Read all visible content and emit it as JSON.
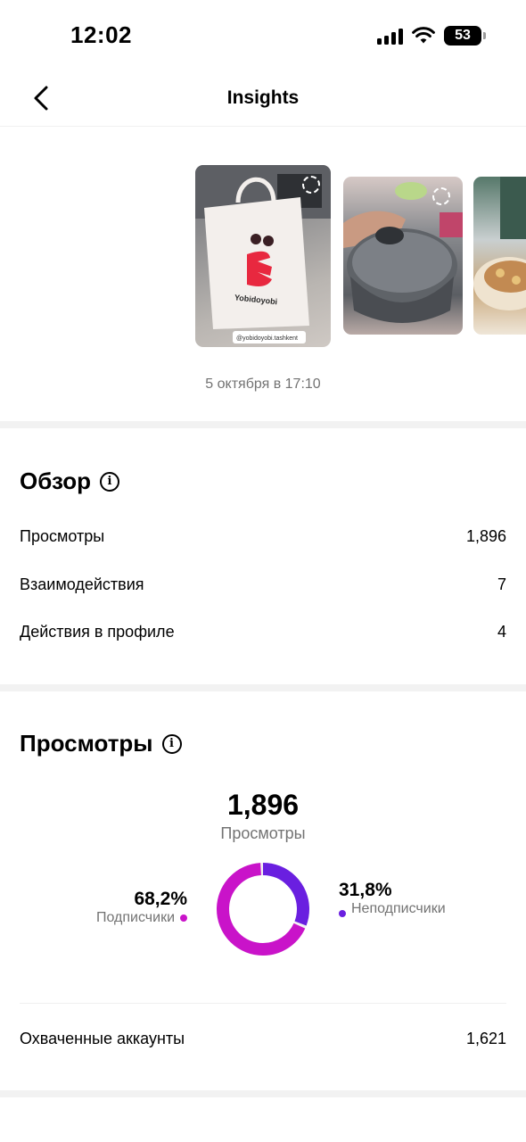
{
  "status_bar": {
    "time": "12:02",
    "battery": "53"
  },
  "header": {
    "title": "Insights"
  },
  "stories": {
    "story_1_handle": "@yobidoyobi.tashkent",
    "story_1_brand": "Yobidoyobi",
    "date": "5 октября в 17:10"
  },
  "overview": {
    "title": "Обзор",
    "rows": [
      {
        "label": "Просмотры",
        "value": "1,896"
      },
      {
        "label": "Взаимодействия",
        "value": "7"
      },
      {
        "label": "Действия в профиле",
        "value": "4"
      }
    ]
  },
  "views": {
    "title": "Просмотры",
    "total": "1,896",
    "total_label": "Просмотры",
    "followers_pct": "68,2%",
    "followers_label": "Подписчики",
    "non_followers_pct": "31,8%",
    "non_followers_label": "Неподписчики",
    "followers_share": 0.682,
    "non_followers_share": 0.318,
    "colors": {
      "followers": "#c913c9",
      "non_followers": "#6a1fe0"
    },
    "accounts_label": "Охваченные аккаунты",
    "accounts_value": "1,621"
  }
}
